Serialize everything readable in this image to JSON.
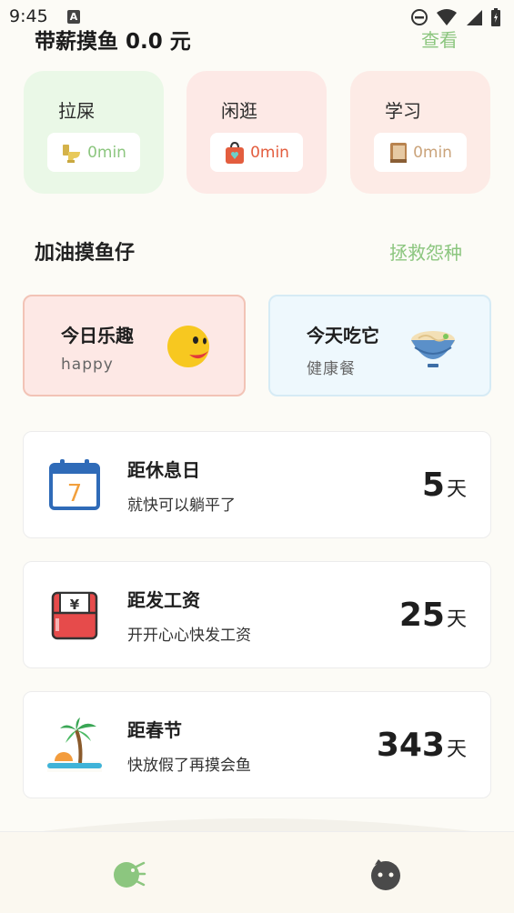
{
  "status": {
    "time": "9:45",
    "a_badge": "A"
  },
  "header": {
    "title": "带薪摸鱼 0.0 元",
    "link": "查看"
  },
  "activities": [
    {
      "label": "拉屎",
      "value": "0min",
      "icon": "toilet-icon"
    },
    {
      "label": "闲逛",
      "value": "0min",
      "icon": "shopping-bag-icon"
    },
    {
      "label": "学习",
      "value": "0min",
      "icon": "book-icon"
    }
  ],
  "section": {
    "title": "加油摸鱼仔",
    "link": "拯救怨种"
  },
  "fun": [
    {
      "title": "今日乐趣",
      "subtitle": "happy",
      "icon": "happy-face-icon"
    },
    {
      "title": "今天吃它",
      "subtitle": "健康餐",
      "icon": "noodle-bowl-icon"
    }
  ],
  "countdowns": [
    {
      "title": "距休息日",
      "subtitle": "就快可以躺平了",
      "number": "5",
      "unit": "天",
      "icon": "calendar-icon",
      "calendar_digit": "7"
    },
    {
      "title": "距发工资",
      "subtitle": "开开心心快发工资",
      "number": "25",
      "unit": "天",
      "icon": "red-envelope-icon",
      "envelope_symbol": "¥"
    },
    {
      "title": "距春节",
      "subtitle": "快放假了再摸会鱼",
      "number": "343",
      "unit": "天",
      "icon": "palm-island-icon"
    }
  ],
  "nav": [
    {
      "name": "fish-icon",
      "active": true
    },
    {
      "name": "face-icon",
      "active": false
    }
  ],
  "colors": {
    "accent_green": "#8cc67f",
    "background": "#fcfbf6",
    "orange": "#e35d3e"
  }
}
